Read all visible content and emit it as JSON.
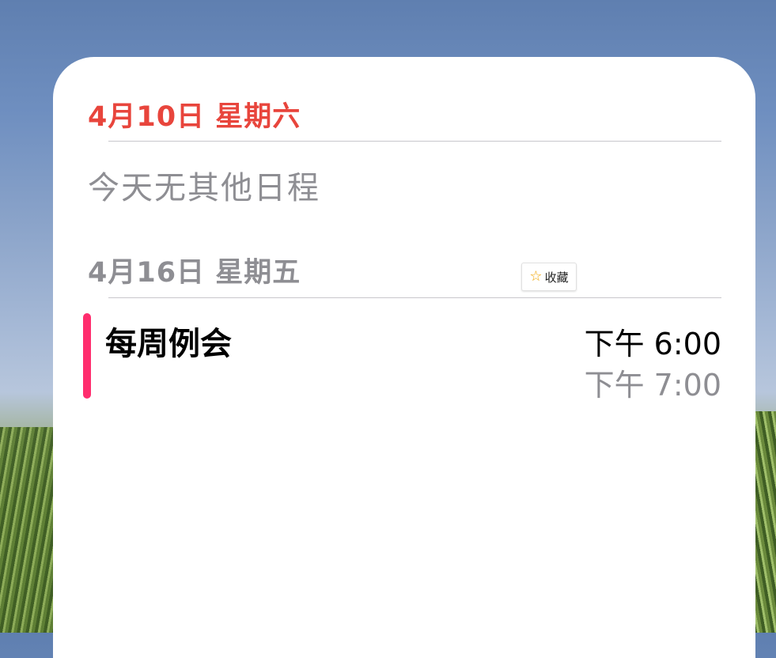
{
  "widget": {
    "today_header": "4月10日 星期六",
    "today_empty_text": "今天无其他日程",
    "next_header": "4月16日 星期五",
    "events": [
      {
        "title": "每周例会",
        "start": "下午 6:00",
        "end": "下午 7:00",
        "color": "#ff2d6e"
      }
    ]
  },
  "favorite_badge": {
    "icon": "star-outline-icon",
    "label": "收藏"
  },
  "colors": {
    "today_accent": "#e8453c",
    "secondary_text": "#8e8e93"
  }
}
